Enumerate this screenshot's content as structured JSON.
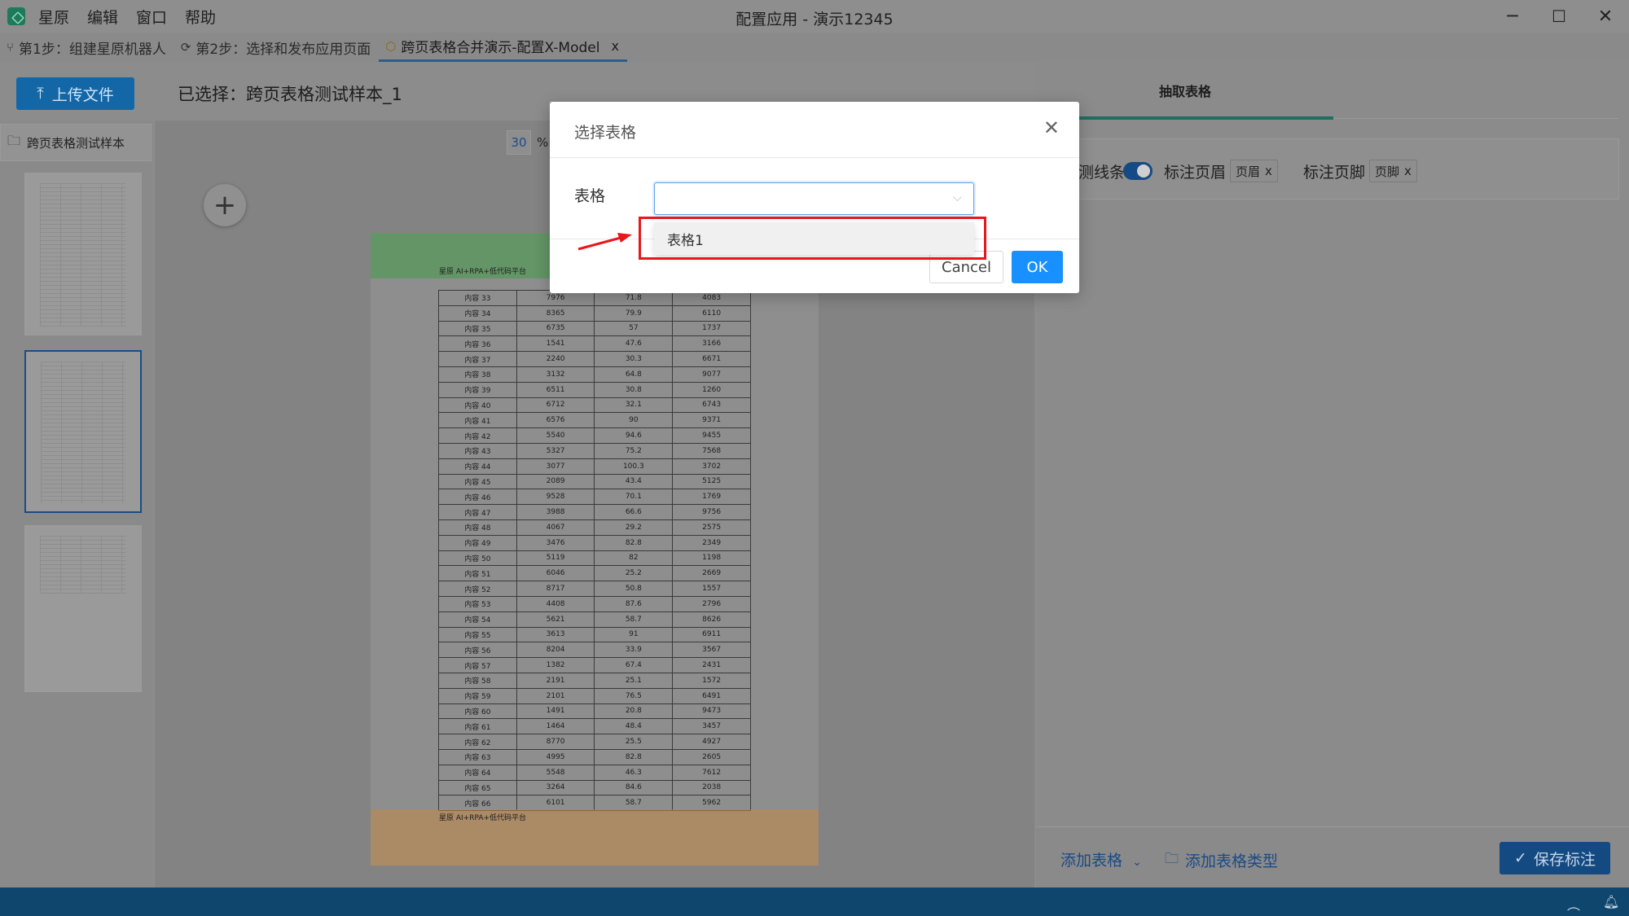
{
  "titlebar": {
    "menu": [
      "星原",
      "编辑",
      "窗口",
      "帮助"
    ],
    "window_title": "配置应用 - 演示12345",
    "minimize": "─",
    "maximize": "☐",
    "close": "✕"
  },
  "tabs": [
    {
      "label": "第1步：组建星原机器人",
      "icon": "branch-icon"
    },
    {
      "label": "第2步：选择和发布应用页面",
      "icon": "page-icon"
    },
    {
      "label": "跨页表格合并演示-配置X-Model",
      "icon": "cube-icon",
      "close": "x"
    }
  ],
  "toolbar": {
    "upload_label": "上传文件",
    "selected_text": "已选择：跨页表格测试样本_1"
  },
  "sidebar": {
    "folder_label": "跨页表格测试样本"
  },
  "viewer": {
    "zoom_value": "30",
    "zoom_unit": "%",
    "add_icon": "+",
    "header_text": "星原 AI+RPA+低代码平台",
    "footer_text": "星原 AI+RPA+低代码平台",
    "rows": [
      [
        "内容 33",
        "7976",
        "71.8",
        "4083"
      ],
      [
        "内容 34",
        "8365",
        "79.9",
        "6110"
      ],
      [
        "内容 35",
        "6735",
        "57",
        "1737"
      ],
      [
        "内容 36",
        "1541",
        "47.6",
        "3166"
      ],
      [
        "内容 37",
        "2240",
        "30.3",
        "6671"
      ],
      [
        "内容 38",
        "3132",
        "64.8",
        "9077"
      ],
      [
        "内容 39",
        "6511",
        "30.8",
        "1260"
      ],
      [
        "内容 40",
        "6712",
        "32.1",
        "6743"
      ],
      [
        "内容 41",
        "6576",
        "90",
        "9371"
      ],
      [
        "内容 42",
        "5540",
        "94.6",
        "9455"
      ],
      [
        "内容 43",
        "5327",
        "75.2",
        "7568"
      ],
      [
        "内容 44",
        "3077",
        "100.3",
        "3702"
      ],
      [
        "内容 45",
        "2089",
        "43.4",
        "5125"
      ],
      [
        "内容 46",
        "9528",
        "70.1",
        "1769"
      ],
      [
        "内容 47",
        "3988",
        "66.6",
        "9756"
      ],
      [
        "内容 48",
        "4067",
        "29.2",
        "2575"
      ],
      [
        "内容 49",
        "3476",
        "82.8",
        "2349"
      ],
      [
        "内容 50",
        "5119",
        "82",
        "1198"
      ],
      [
        "内容 51",
        "6046",
        "25.2",
        "2669"
      ],
      [
        "内容 52",
        "8717",
        "50.8",
        "1557"
      ],
      [
        "内容 53",
        "4408",
        "87.6",
        "2796"
      ],
      [
        "内容 54",
        "5621",
        "58.7",
        "8626"
      ],
      [
        "内容 55",
        "3613",
        "91",
        "6911"
      ],
      [
        "内容 56",
        "8204",
        "33.9",
        "3567"
      ],
      [
        "内容 57",
        "1382",
        "67.4",
        "2431"
      ],
      [
        "内容 58",
        "2191",
        "25.1",
        "1572"
      ],
      [
        "内容 59",
        "2101",
        "76.5",
        "6491"
      ],
      [
        "内容 60",
        "1491",
        "20.8",
        "9473"
      ],
      [
        "内容 61",
        "1464",
        "48.4",
        "3457"
      ],
      [
        "内容 62",
        "8770",
        "25.5",
        "4927"
      ],
      [
        "内容 63",
        "4995",
        "82.8",
        "2605"
      ],
      [
        "内容 64",
        "5548",
        "46.3",
        "7612"
      ],
      [
        "内容 65",
        "3264",
        "84.6",
        "2038"
      ],
      [
        "内容 66",
        "6101",
        "58.7",
        "5962"
      ]
    ]
  },
  "right_panel": {
    "tab_label": "抽取表格",
    "line_label": "测线条",
    "header_label": "标注页眉",
    "header_chip": "页眉",
    "footer_label": "标注页脚",
    "footer_chip": "页脚",
    "chip_close": "x",
    "add_table": "添加表格",
    "add_table_type": "添加表格类型",
    "save_label": "保存标注"
  },
  "modal": {
    "title": "选择表格",
    "close": "✕",
    "field_label": "表格",
    "select_value": "",
    "cancel": "Cancel",
    "ok": "OK",
    "options": [
      "表格1"
    ]
  },
  "colors": {
    "accent": "#1890ff",
    "highlight": "#e8171b",
    "statusbar": "#0f466e"
  }
}
